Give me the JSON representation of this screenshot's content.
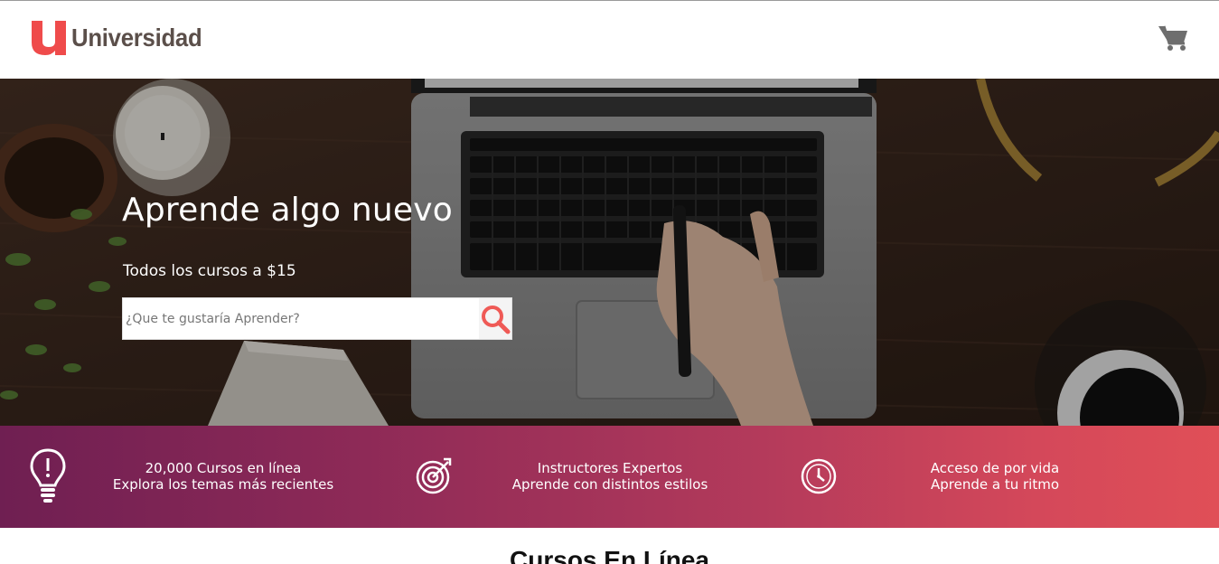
{
  "header": {
    "logo_text": "Universidad",
    "logo_mark": "u",
    "logo_color": "#ef4b4b",
    "cart_icon": "shopping-cart-icon"
  },
  "hero": {
    "title": "Aprende algo nuevo",
    "subtitle": "Todos los cursos a $15",
    "search": {
      "placeholder": "¿Que te gustaría Aprender?",
      "value": "",
      "button_icon": "search-icon"
    }
  },
  "features": [
    {
      "icon": "lightbulb-icon",
      "line1": "20,000 Cursos en línea",
      "line2": "Explora los temas más recientes"
    },
    {
      "icon": "target-icon",
      "line1": "Instructores Expertos",
      "line2": "Aprende con distintos estilos"
    },
    {
      "icon": "clock-icon",
      "line1": "Acceso de por vida",
      "line2": "Aprende a tu ritmo"
    }
  ],
  "section": {
    "title": "Cursos En Línea"
  },
  "colors": {
    "accent": "#ef4b4b",
    "gradient_start": "#6f1f52",
    "gradient_end": "#e04f57"
  }
}
